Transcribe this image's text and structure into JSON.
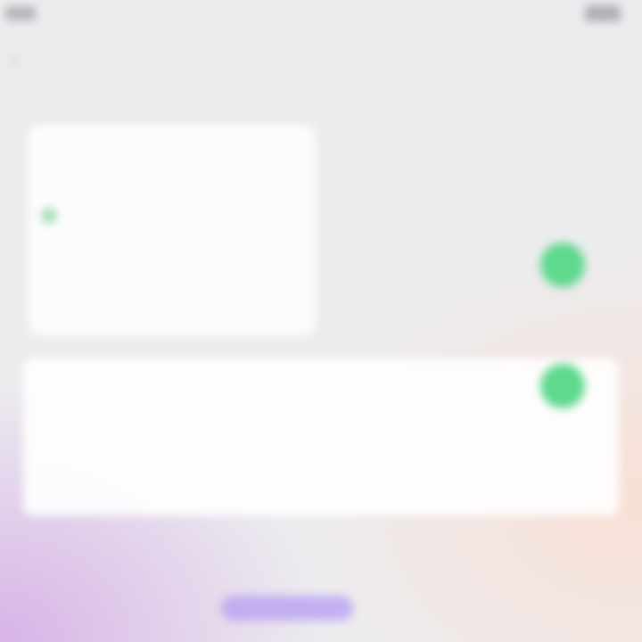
{
  "status_bar": {
    "carrier": "",
    "network": "",
    "time": "",
    "battery_percent": ""
  },
  "nav": {
    "back_label": ""
  },
  "top_card": {
    "title": "",
    "rows": [
      "",
      "",
      ""
    ]
  },
  "bottom_card": {
    "rows": [
      "",
      "",
      ""
    ],
    "row2_value": ""
  },
  "footer": {
    "text": "",
    "button_label": ""
  },
  "colors": {
    "accent": "#f5a25a",
    "toggle_on": "#5fd98d",
    "button": "#b79cf0"
  },
  "icons": {
    "back": "chevron-left-icon",
    "signal": "signal-icon",
    "battery": "battery-icon",
    "status_dot": "status-dot-icon"
  }
}
